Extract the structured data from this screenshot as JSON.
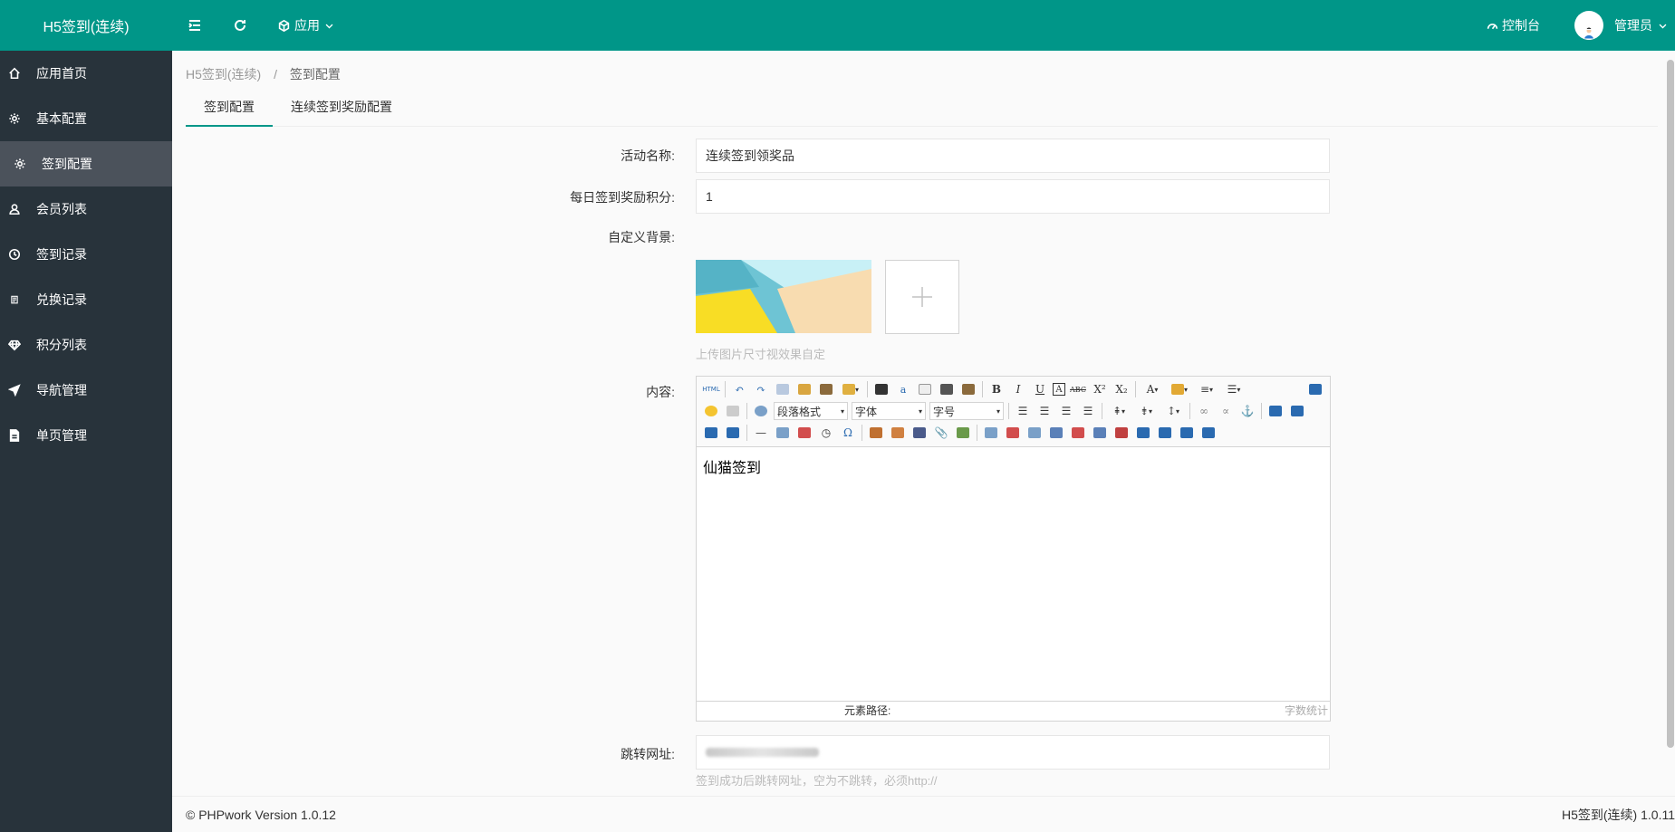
{
  "header": {
    "logo": "H5签到(连续)",
    "app_menu": "应用",
    "dashboard": "控制台",
    "user": "管理员"
  },
  "sidebar": {
    "items": [
      {
        "label": "应用首页",
        "icon": "home-icon"
      },
      {
        "label": "基本配置",
        "icon": "gear-icon"
      },
      {
        "label": "签到配置",
        "icon": "gear-icon"
      },
      {
        "label": "会员列表",
        "icon": "user-icon"
      },
      {
        "label": "签到记录",
        "icon": "clock-icon"
      },
      {
        "label": "兑换记录",
        "icon": "document-icon"
      },
      {
        "label": "积分列表",
        "icon": "diamond-icon"
      },
      {
        "label": "导航管理",
        "icon": "send-icon"
      },
      {
        "label": "单页管理",
        "icon": "file-icon"
      }
    ],
    "active_index": 2
  },
  "breadcrumb": {
    "parent": "H5签到(连续)",
    "separator": "/",
    "current": "签到配置"
  },
  "tabs": [
    {
      "label": "签到配置"
    },
    {
      "label": "连续签到奖励配置"
    }
  ],
  "form": {
    "activity_name_label": "活动名称:",
    "activity_name_value": "连续签到领奖品",
    "daily_points_label": "每日签到奖励积分:",
    "daily_points_value": "1",
    "background_label": "自定义背景:",
    "background_hint": "上传图片尺寸视效果自定",
    "content_label": "内容:",
    "redirect_label": "跳转网址:",
    "redirect_value": "",
    "redirect_hint": "签到成功后跳转网址，空为不跳转，必须http://"
  },
  "editor": {
    "content": "仙猫签到",
    "paragraph_select": "段落格式",
    "font_select": "字体",
    "size_select": "字号",
    "element_path": "元素路径:",
    "word_count": "字数统计"
  },
  "footer": {
    "copyright": "© PHPwork Version 1.0.12",
    "right": "H5签到(连续) 1.0.11"
  },
  "colors": {
    "primary": "#009688",
    "sidebar_bg": "#28333b",
    "sidebar_active": "#4b525b"
  }
}
